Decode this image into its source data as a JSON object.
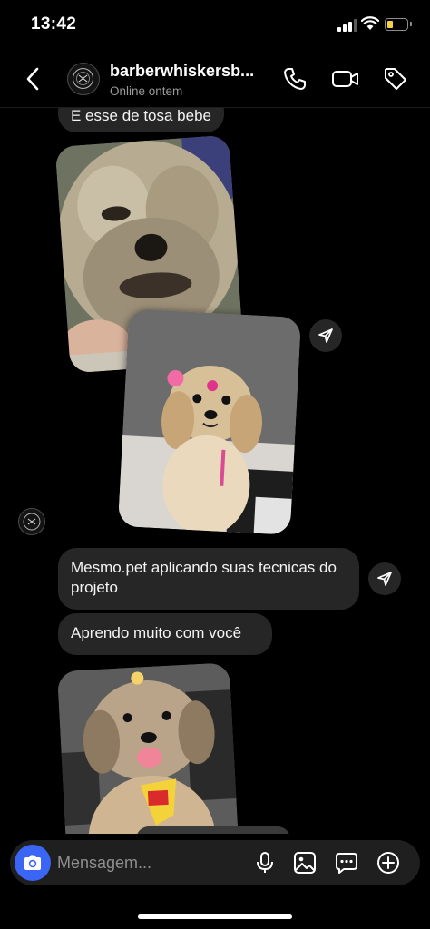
{
  "status_bar": {
    "time": "13:42"
  },
  "header": {
    "contact_name": "barberwhiskersb...",
    "contact_status": "Online ontem"
  },
  "messages": {
    "partial_top": "E esse de tosa bebe",
    "msg1": "Mesmo.pet  aplicando suas tecnicas do projeto",
    "msg2": "Aprendo muito com você"
  },
  "composer": {
    "placeholder": "Mensagem..."
  },
  "colors": {
    "background": "#000000",
    "bubble": "#262626",
    "camera_button": "#3b66f5",
    "battery": "#f6cf45",
    "secondary_text": "#9a9a9a"
  },
  "icons": {
    "header": [
      "back-icon",
      "phone-icon",
      "video-icon",
      "tag-icon"
    ],
    "composer": [
      "camera-icon",
      "microphone-icon",
      "gallery-icon",
      "sticker-icon",
      "add-icon"
    ]
  }
}
